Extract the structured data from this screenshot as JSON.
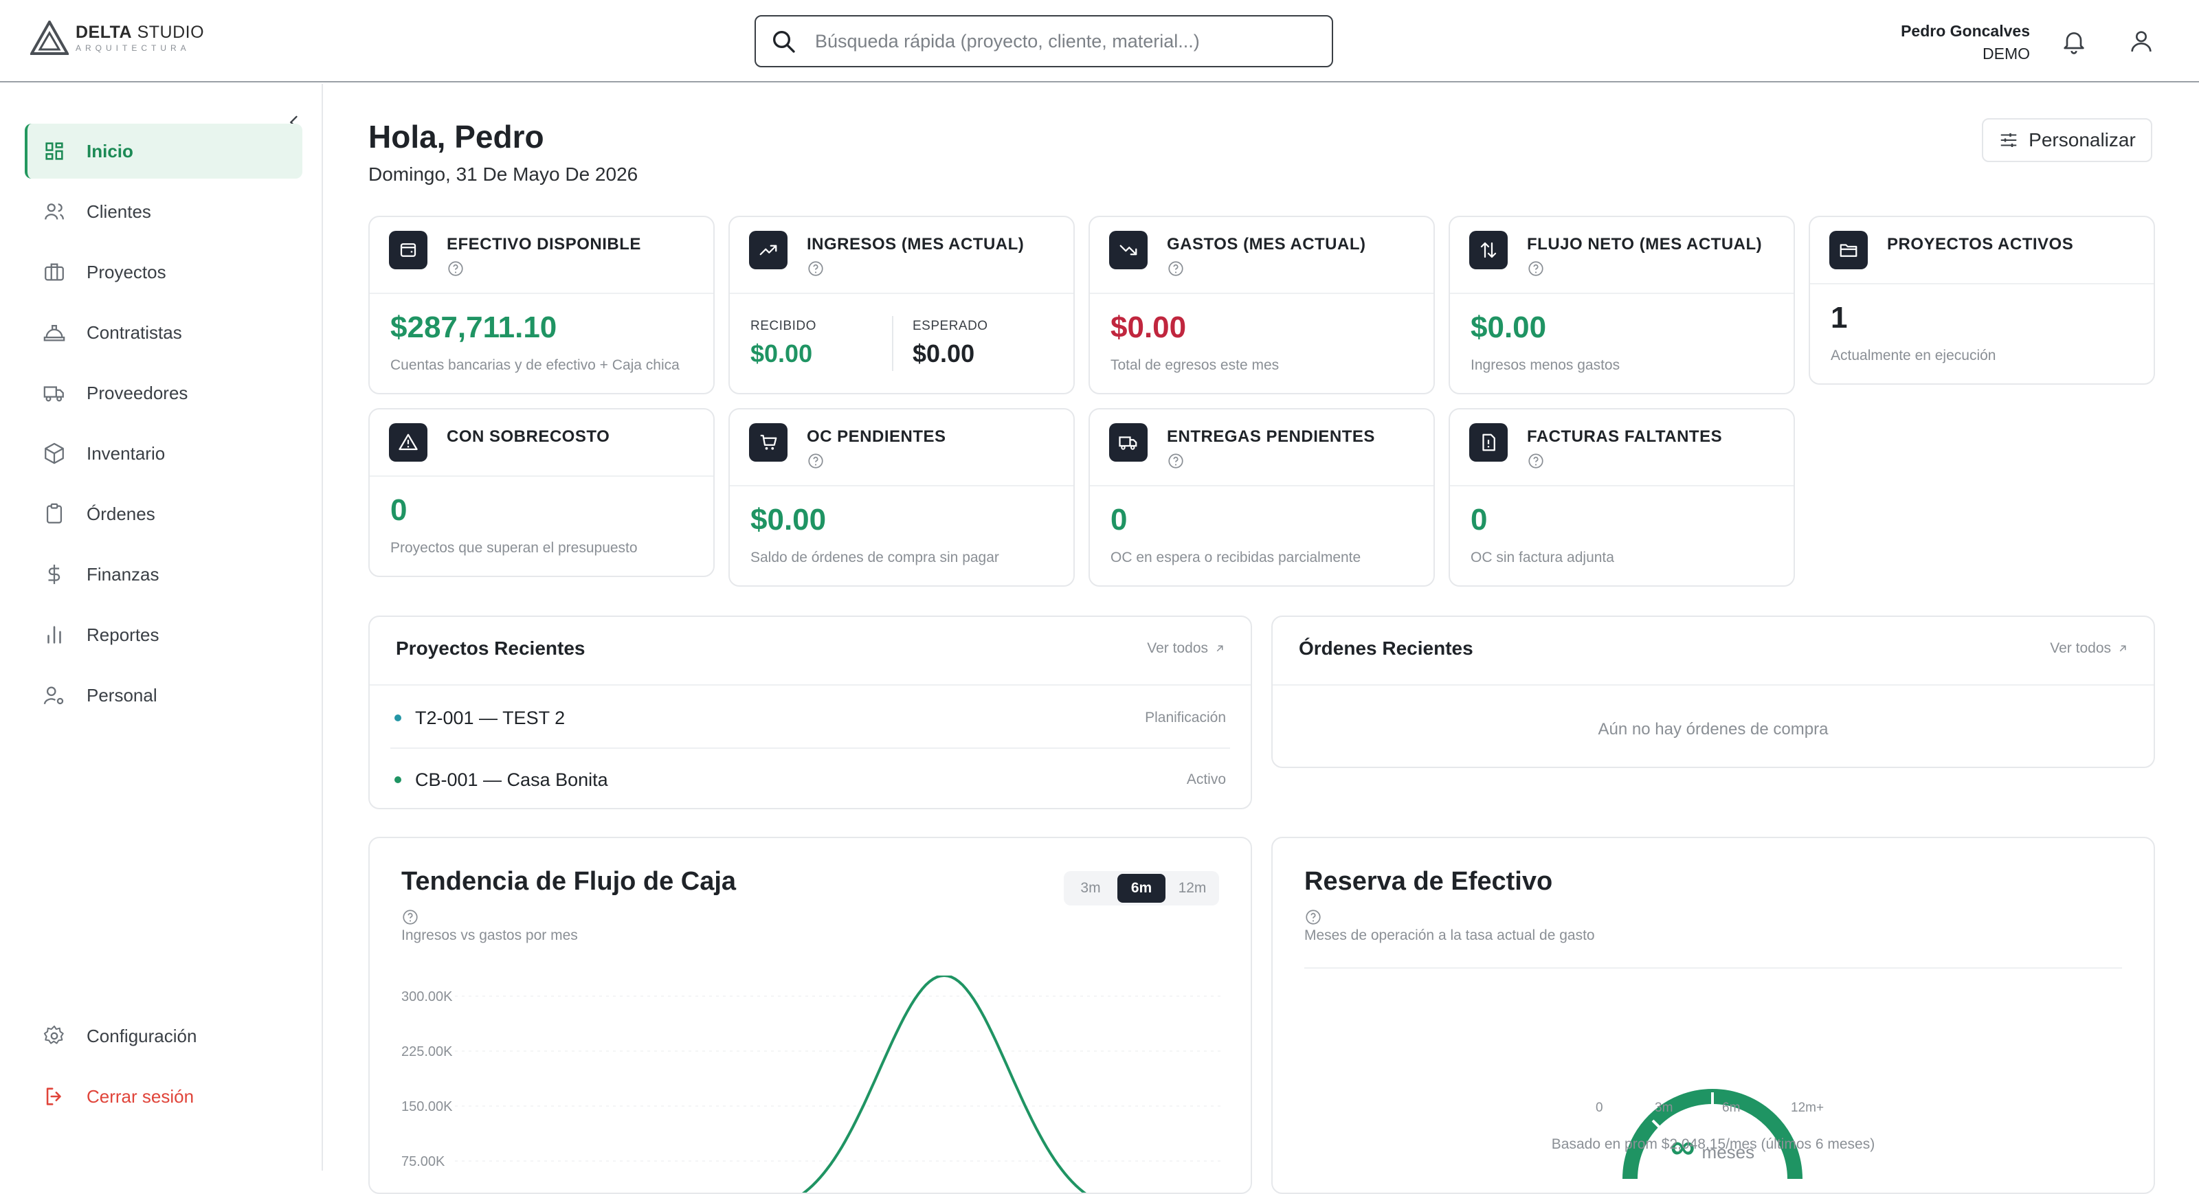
{
  "app": {
    "logo_main_bold": "DELTA",
    "logo_main": " STUDIO",
    "logo_sub": "ARQUITECTURA"
  },
  "search": {
    "placeholder": "Búsqueda rápida (proyecto, cliente, material...)"
  },
  "user": {
    "name": "Pedro Goncalves",
    "role": "DEMO"
  },
  "sidebar": {
    "items": [
      {
        "label": "Inicio",
        "icon": "grid-icon",
        "active": true
      },
      {
        "label": "Clientes",
        "icon": "users-icon"
      },
      {
        "label": "Proyectos",
        "icon": "briefcase-icon"
      },
      {
        "label": "Contratistas",
        "icon": "hardhat-icon"
      },
      {
        "label": "Proveedores",
        "icon": "truck-icon"
      },
      {
        "label": "Inventario",
        "icon": "box-icon"
      },
      {
        "label": "Órdenes",
        "icon": "clipboard-icon"
      },
      {
        "label": "Finanzas",
        "icon": "dollar-icon"
      },
      {
        "label": "Reportes",
        "icon": "bar-chart-icon"
      },
      {
        "label": "Personal",
        "icon": "user-cog-icon"
      }
    ],
    "settings": "Configuración",
    "logout": "Cerrar sesión"
  },
  "header": {
    "greeting": "Hola, Pedro",
    "date": "Domingo, 31 De Mayo De 2026",
    "customize": "Personalizar"
  },
  "kpis": {
    "efectivo": {
      "title": "EFECTIVO DISPONIBLE",
      "value": "$287,711.10",
      "desc": "Cuentas bancarias y de efectivo + Caja chica"
    },
    "ingresos": {
      "title": "INGRESOS (MES ACTUAL)",
      "recibido_label": "RECIBIDO",
      "recibido": "$0.00",
      "esperado_label": "ESPERADO",
      "esperado": "$0.00"
    },
    "gastos": {
      "title": "GASTOS (MES ACTUAL)",
      "value": "$0.00",
      "desc": "Total de egresos este mes"
    },
    "flujo": {
      "title": "FLUJO NETO (MES ACTUAL)",
      "value": "$0.00",
      "desc": "Ingresos menos gastos"
    },
    "proyectos": {
      "title": "PROYECTOS ACTIVOS",
      "value": "1",
      "desc": "Actualmente en ejecución"
    },
    "sobrecosto": {
      "title": "CON SOBRECOSTO",
      "value": "0",
      "desc": "Proyectos que superan el presupuesto"
    },
    "oc": {
      "title": "OC PENDIENTES",
      "value": "$0.00",
      "desc": "Saldo de órdenes de compra sin pagar"
    },
    "entregas": {
      "title": "ENTREGAS PENDIENTES",
      "value": "0",
      "desc": "OC en espera o recibidas parcialmente"
    },
    "facturas": {
      "title": "FACTURAS FALTANTES",
      "value": "0",
      "desc": "OC sin factura adjunta"
    }
  },
  "recent_projects": {
    "title": "Proyectos Recientes",
    "link": "Ver todos",
    "rows": [
      {
        "name": "T2-001 — TEST 2",
        "status": "Planificación",
        "dot": "#2596a6"
      },
      {
        "name": "CB-001 — Casa Bonita",
        "status": "Activo",
        "dot": "#1f9463"
      }
    ]
  },
  "recent_orders": {
    "title": "Órdenes Recientes",
    "link": "Ver todos",
    "empty": "Aún no hay órdenes de compra"
  },
  "cashflow": {
    "title": "Tendencia de Flujo de Caja",
    "subtitle": "Ingresos vs gastos por mes",
    "ranges": [
      "3m",
      "6m",
      "12m"
    ],
    "selected": "6m"
  },
  "reserve": {
    "title": "Reserva de Efectivo",
    "subtitle": "Meses de operación a la tasa actual de gasto",
    "value": "∞",
    "unit": "meses",
    "scale": [
      "0",
      "3m",
      "6m",
      "12m+"
    ],
    "footer": "Basado en prom $2,048.15/mes (últimos 6 meses)"
  },
  "chart_data": {
    "type": "line",
    "y_tick_labels": [
      "300.00K",
      "225.00K",
      "150.00K",
      "75.00K"
    ],
    "series": [
      {
        "values": [
          0,
          300000,
          0
        ]
      }
    ],
    "ylim": [
      0,
      300000
    ],
    "grid": true
  },
  "colors": {
    "accent": "#1f9463",
    "negative": "#c0263e",
    "icon_bg": "#1e2430"
  }
}
